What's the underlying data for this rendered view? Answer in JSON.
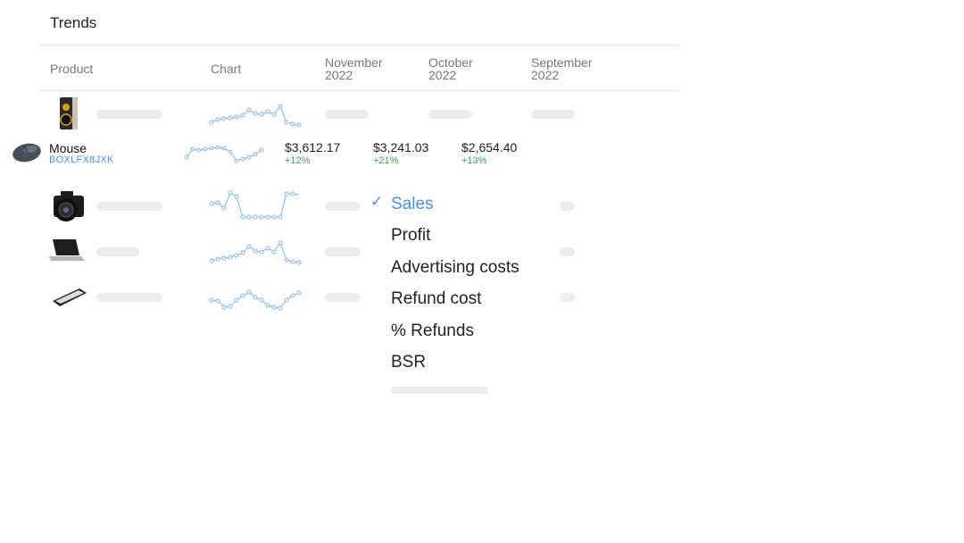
{
  "header": {
    "title": "Trends"
  },
  "table": {
    "columns": {
      "product": "Product",
      "chart": "Chart",
      "col1": [
        "November",
        "2022"
      ],
      "col2": [
        "October",
        "2022"
      ],
      "col3": [
        "September",
        "2022"
      ]
    },
    "highlighted_row": {
      "name": "Mouse",
      "sku": "BOXLFX8JXK",
      "values": [
        {
          "amount": "$3,612.17",
          "change": "+12%"
        },
        {
          "amount": "$3,241.03",
          "change": "+21%"
        },
        {
          "amount": "$2,654.40",
          "change": "+13%"
        }
      ]
    },
    "row_icons": [
      "speaker-icon",
      "mouse-icon",
      "camera-icon",
      "laptop-icon",
      "smartphone-icon"
    ]
  },
  "metric_menu": {
    "selected": "Sales",
    "items": [
      "Sales",
      "Profit",
      "Advertising costs",
      "Refund cost",
      "% Refunds",
      "BSR"
    ]
  },
  "colors": {
    "accent": "#4a90e2",
    "positive": "#3aa655",
    "sparkline": "#7fb3ea",
    "placeholder": "#ececec"
  }
}
